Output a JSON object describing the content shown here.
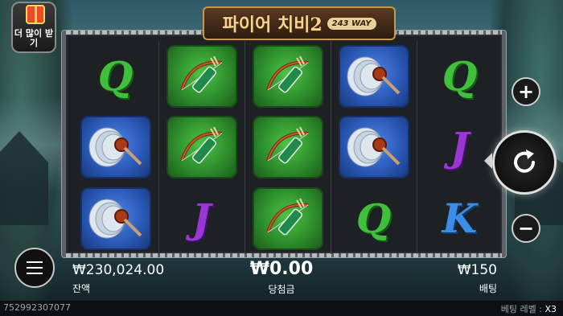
{
  "game": {
    "title": "파이어 치비2",
    "ways_badge": "243 WAY"
  },
  "promo": {
    "more_wins_label": "더 많이 받기"
  },
  "reels": [
    [
      "Q",
      "fan",
      "fan"
    ],
    [
      "bow",
      "bow",
      "J"
    ],
    [
      "bow",
      "bow",
      "bow"
    ],
    [
      "fan",
      "fan",
      "Q"
    ],
    [
      "Q",
      "J",
      "K"
    ]
  ],
  "controls": {
    "plus_icon": "+",
    "minus_icon": "−",
    "spin_icon": "spin-icon",
    "menu_icon": "menu-icon"
  },
  "status": {
    "balance_value": "₩230,024.00",
    "balance_label": "잔액",
    "win_value": "₩0.00",
    "win_label": "당첨금",
    "bet_value": "₩150",
    "bet_label": "배팅"
  },
  "footer": {
    "session_id": "752992307077",
    "bet_level_label": "베팅 레벨 :",
    "bet_level_value": "X3"
  },
  "colors": {
    "q_green": "#3fbf3c",
    "j_purple": "#9a35d6",
    "k_blue": "#3b8ee8",
    "tile_green": "#2c8a2a",
    "tile_blue": "#2a57b5"
  }
}
